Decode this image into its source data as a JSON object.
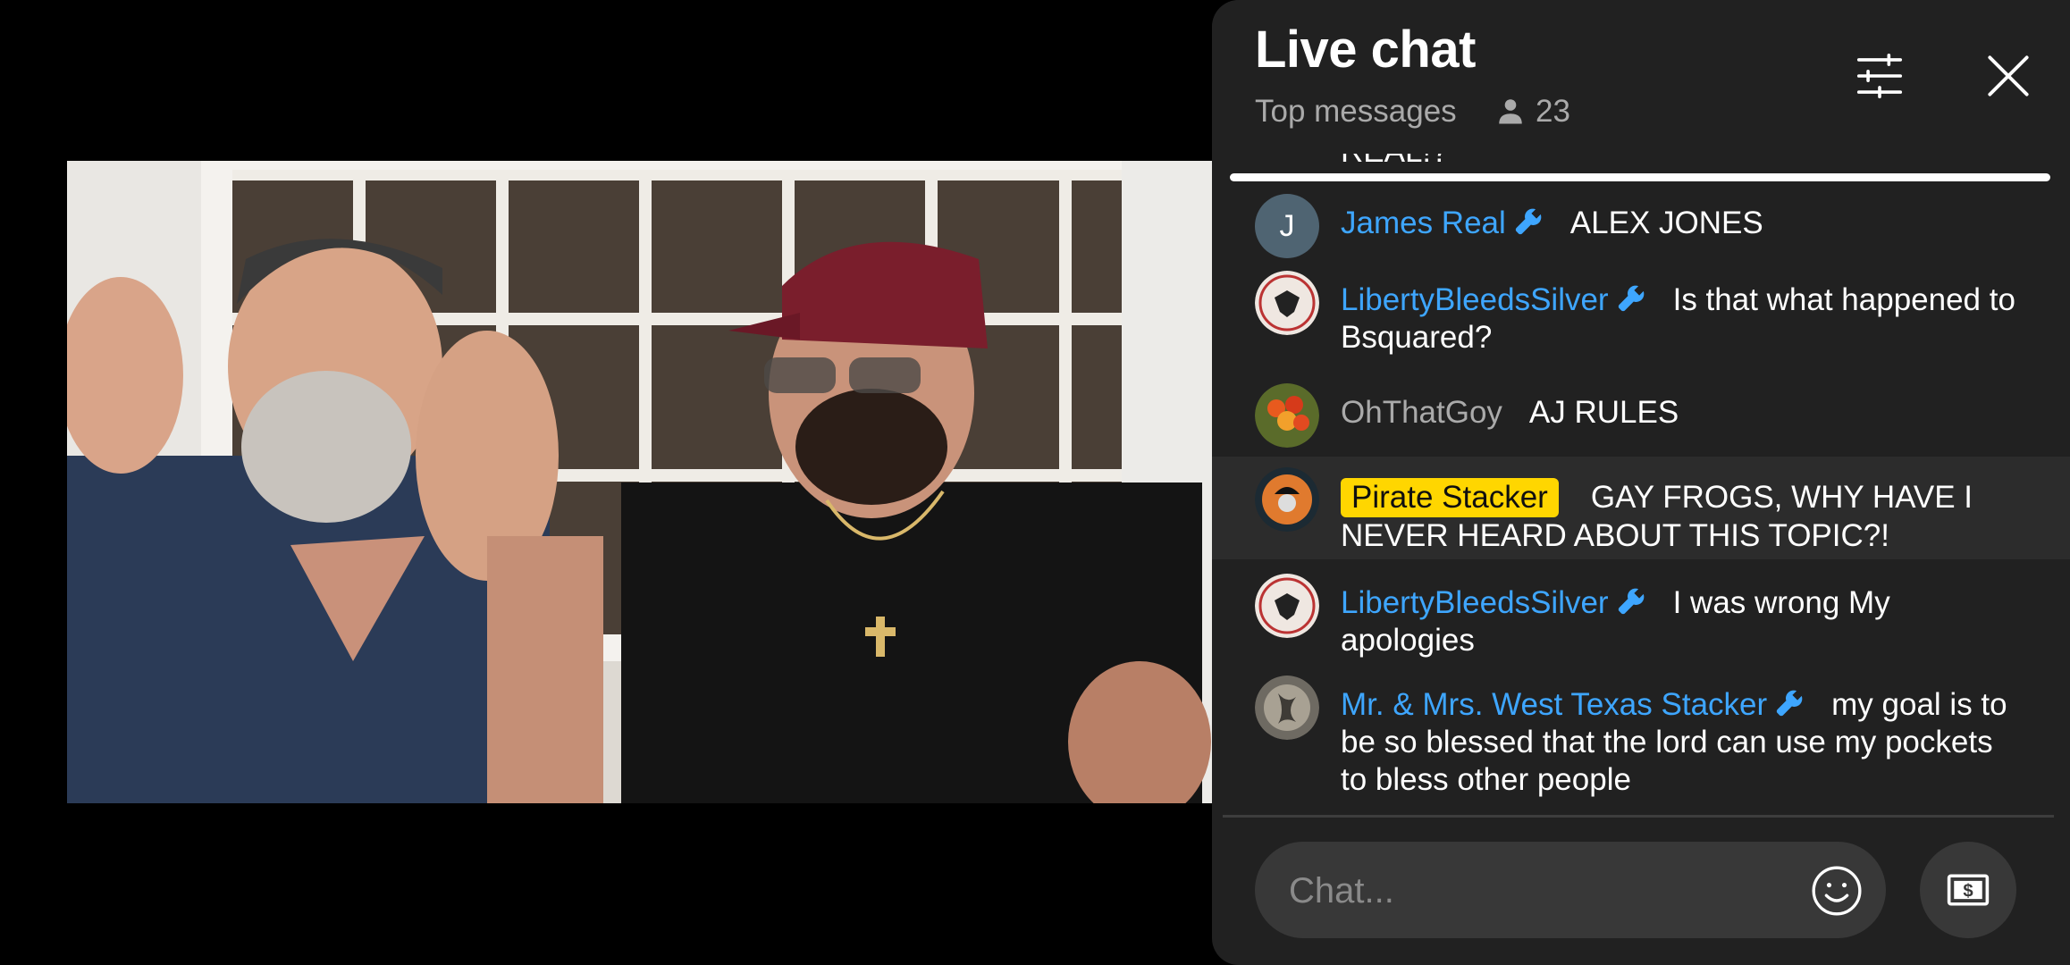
{
  "header": {
    "title": "Live chat",
    "filter_label": "Top messages",
    "viewer_count": "23"
  },
  "clipped_message": "REAL!?",
  "messages": [
    {
      "avatar_letter": "J",
      "author": "James Real",
      "moderator": true,
      "text": "ALEX JONES"
    },
    {
      "author": "LibertyBleedsSilver",
      "moderator": true,
      "text": "Is that what happened to Bsquared?"
    },
    {
      "author": "OhThatGoy",
      "moderator": false,
      "text": "AJ RULES"
    },
    {
      "author": "Pirate Stacker",
      "owner": true,
      "text": "GAY FROGS, WHY HAVE I NEVER HEARD ABOUT THIS TOPIC?!"
    },
    {
      "author": "LibertyBleedsSilver",
      "moderator": true,
      "text": "I was wrong My apologies"
    },
    {
      "author": "Mr. & Mrs. West Texas Stacker",
      "moderator": true,
      "text": "my goal is to be so blessed that the lord can use my pockets to bless other people"
    }
  ],
  "input": {
    "placeholder": "Chat..."
  },
  "icons": {
    "filter": "sliders-icon",
    "close": "close-icon",
    "viewers": "person-icon",
    "moderator": "wrench-icon",
    "emoji": "smiley-icon",
    "super_chat": "dollar-bill-icon"
  },
  "colors": {
    "author": "#3ea6ff",
    "owner_badge": "#ffd600",
    "panel": "#212121"
  }
}
